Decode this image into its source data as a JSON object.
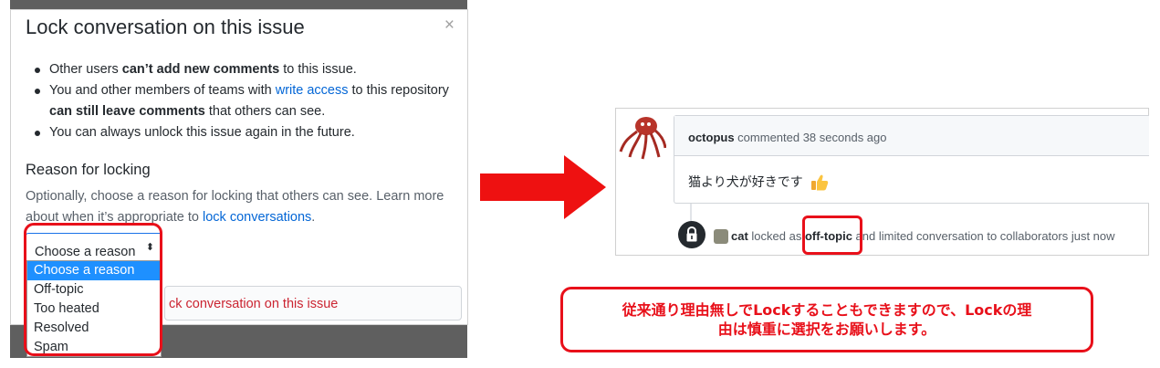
{
  "dialog": {
    "title": "Lock conversation on this issue",
    "close_label": "×",
    "bullets": [
      {
        "pre": "Other users ",
        "bold": "can’t add new comments",
        "post": " to this issue."
      },
      {
        "pre": "You and other members of teams with ",
        "link": "write access",
        "mid": " to this repository ",
        "bold": "can still leave comments",
        "post": " that others can see."
      },
      {
        "text": "You can always unlock this issue again in the future."
      }
    ],
    "reason_heading": "Reason for locking",
    "reason_desc_pre": "Optionally, choose a reason for locking that others can see. Learn more about when it’s appropriate to ",
    "reason_desc_link": "lock conversations",
    "reason_desc_post": ".",
    "select_value": "Choose a reason",
    "select_arrows": "⬍",
    "options": [
      "Choose a reason",
      "Off-topic",
      "Too heated",
      "Resolved",
      "Spam"
    ],
    "selected_option": "Choose a reason",
    "lock_button_label": "ck conversation on this issue"
  },
  "comment": {
    "author": "octopus",
    "header_rest": " commented 38 seconds ago",
    "body": "猫より犬が好きです",
    "reaction_icon": "thumbs-up-icon"
  },
  "event": {
    "actor": "cat",
    "pre": " locked as ",
    "reason": "off-topic",
    "post": " and limited conversation to collaborators just now"
  },
  "notice": {
    "line1": "従来通り理由無しでLockすることもできますので、Lockの理",
    "line2": "由は慎重に選択をお願いします。"
  },
  "colors": {
    "accent_red": "#e8101a",
    "link_blue": "#0366d6",
    "selected_option_bg": "#1e90ff",
    "danger_text": "#cb2431"
  }
}
